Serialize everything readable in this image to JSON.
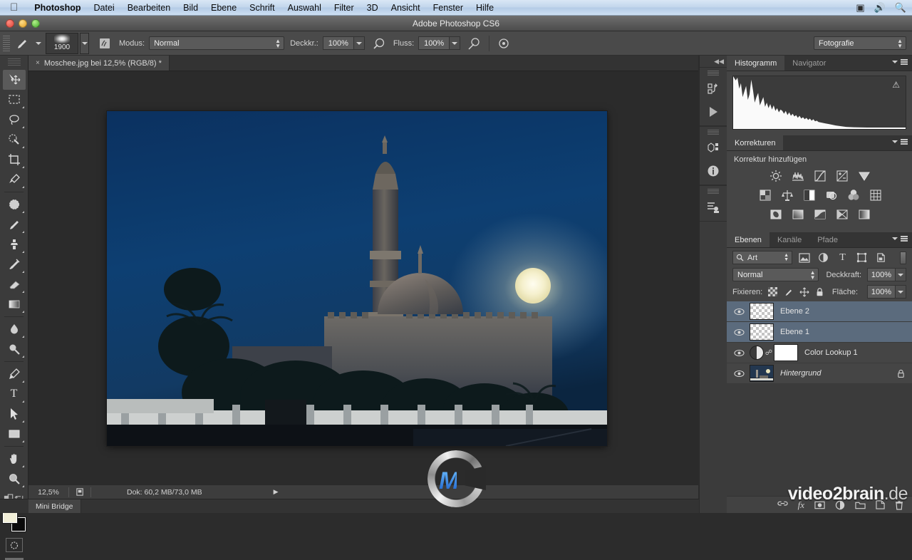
{
  "macos_menubar": {
    "apple_icon": "apple-icon",
    "app_name": "Photoshop",
    "menus": [
      "Datei",
      "Bearbeiten",
      "Bild",
      "Ebene",
      "Schrift",
      "Auswahl",
      "Filter",
      "3D",
      "Ansicht",
      "Fenster",
      "Hilfe"
    ],
    "status_icons": [
      "display-icon",
      "volume-icon",
      "search-icon"
    ]
  },
  "window": {
    "title": "Adobe Photoshop CS6"
  },
  "options_bar": {
    "brush_size": "1900",
    "mode_label": "Modus:",
    "mode_value": "Normal",
    "opacity_label": "Deckkr.:",
    "opacity_value": "100%",
    "flow_label": "Fluss:",
    "flow_value": "100%",
    "workspace_value": "Fotografie"
  },
  "document": {
    "tab_label": "Moschee.jpg bei 12,5% (RGB/8) *",
    "close_glyph": "×"
  },
  "toolbox": {
    "tools": [
      {
        "name": "move-tool",
        "glyph": "move"
      },
      {
        "name": "marquee-tool",
        "glyph": "marquee"
      },
      {
        "name": "lasso-tool",
        "glyph": "lasso"
      },
      {
        "name": "quick-selection-tool",
        "glyph": "quickselect"
      },
      {
        "name": "crop-tool",
        "glyph": "crop"
      },
      {
        "name": "eyedropper-tool",
        "glyph": "eyedropper"
      },
      {
        "name": "spot-healing-tool",
        "glyph": "healing"
      },
      {
        "name": "brush-tool",
        "glyph": "brush"
      },
      {
        "name": "clone-stamp-tool",
        "glyph": "stamp"
      },
      {
        "name": "history-brush-tool",
        "glyph": "historybrush"
      },
      {
        "name": "eraser-tool",
        "glyph": "eraser"
      },
      {
        "name": "gradient-tool",
        "glyph": "gradient"
      },
      {
        "name": "blur-tool",
        "glyph": "blur"
      },
      {
        "name": "dodge-tool",
        "glyph": "dodge"
      },
      {
        "name": "pen-tool",
        "glyph": "pen"
      },
      {
        "name": "type-tool",
        "glyph": "T"
      },
      {
        "name": "path-selection-tool",
        "glyph": "pathselect"
      },
      {
        "name": "rectangle-tool",
        "glyph": "rect"
      },
      {
        "name": "hand-tool",
        "glyph": "hand"
      },
      {
        "name": "zoom-tool",
        "glyph": "zoom"
      }
    ],
    "foreground_color": "#f2efd8",
    "background_color": "#0a0a0a"
  },
  "icon_dock": {
    "collapse_glyph": "◀◀",
    "items": [
      "history-panel-icon",
      "actions-play-icon",
      "3d-panel-icon",
      "info-panel-icon",
      "properties-panel-icon"
    ]
  },
  "histogram_panel": {
    "tabs": [
      {
        "label": "Histogramm",
        "active": true
      },
      {
        "label": "Navigator",
        "active": false
      }
    ],
    "warning_glyph": "⚠"
  },
  "adjustments_panel": {
    "tabs": [
      {
        "label": "Korrekturen",
        "active": true
      }
    ],
    "title": "Korrektur hinzufügen",
    "rows": [
      [
        "brightness-contrast-icon",
        "levels-icon",
        "curves-icon",
        "exposure-icon",
        "vibrance-icon"
      ],
      [
        "hue-saturation-icon",
        "color-balance-icon",
        "black-white-icon",
        "photo-filter-icon",
        "channel-mixer-icon",
        "color-lookup-icon"
      ],
      [
        "invert-icon",
        "posterize-icon",
        "threshold-icon",
        "selective-color-icon",
        "gradient-map-icon"
      ]
    ]
  },
  "layers_panel": {
    "tabs": [
      {
        "label": "Ebenen",
        "active": true
      },
      {
        "label": "Kanäle",
        "active": false
      },
      {
        "label": "Pfade",
        "active": false
      }
    ],
    "filter_label": "Art",
    "filter_icons": [
      "filter-pixel-icon",
      "filter-adjustment-icon",
      "filter-type-icon",
      "filter-shape-icon",
      "filter-smart-icon"
    ],
    "blend_mode": "Normal",
    "opacity_label": "Deckkraft:",
    "opacity_value": "100%",
    "lock_label": "Fixieren:",
    "lock_icons": [
      "lock-transparency-icon",
      "lock-image-icon",
      "lock-position-icon",
      "lock-all-icon"
    ],
    "fill_label": "Fläche:",
    "fill_value": "100%",
    "layers": [
      {
        "name": "Ebene 2",
        "thumb": "checker",
        "selected": true,
        "visible": true,
        "locked": false,
        "italic": false
      },
      {
        "name": "Ebene 1",
        "thumb": "checker",
        "selected": true,
        "visible": true,
        "locked": false,
        "italic": false
      },
      {
        "name": "Color Lookup 1",
        "thumb": "adjustment",
        "selected": false,
        "visible": true,
        "locked": false,
        "italic": false
      },
      {
        "name": "Hintergrund",
        "thumb": "photo",
        "selected": false,
        "visible": true,
        "locked": true,
        "italic": true
      }
    ],
    "bottom_icons": [
      "link-layers-icon",
      "layer-style-fx-icon",
      "layer-mask-icon",
      "new-adjustment-icon",
      "new-group-icon",
      "new-layer-icon",
      "delete-layer-icon"
    ]
  },
  "status_bar": {
    "zoom": "12,5%",
    "doc_info": "Dok: 60,2 MB/73,0 MB",
    "arrow_glyph": "▶",
    "mini_bridge_tab": "Mini Bridge"
  },
  "watermark": {
    "brand": "video2brain",
    "tld": ".de",
    "logo_letter": "M"
  },
  "canvas_image": {
    "description": "Night photo of a mosque with minaret, dome, moon, streetlight and palm trees",
    "sky_color": "#0d3a6b",
    "moon_color": "#f2eec8",
    "cursor": "no-entry-cursor"
  }
}
